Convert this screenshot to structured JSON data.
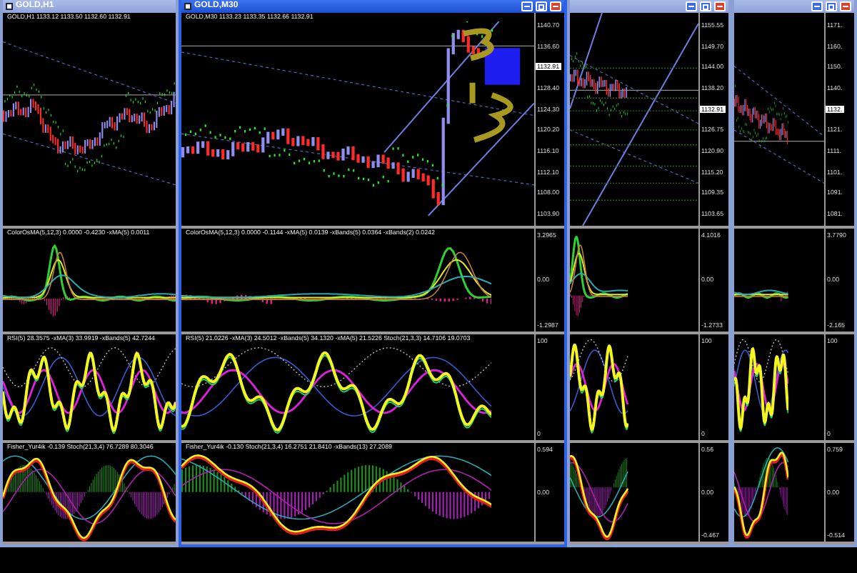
{
  "windows": [
    {
      "title": "GOLD,H1",
      "active": false,
      "title_buttons": false,
      "panes": [
        {
          "kind": "price",
          "header": "GOLD,H1 1133.12 1133.50 1132.60 1132.91"
        },
        {
          "kind": "osma",
          "header": "ColorOsMA(5,12,3) 0.0000 -0.4230 -xMA(5) 0.0011"
        },
        {
          "kind": "rsi",
          "header": "RSI(5) 28.3575 -xMA(3) 33.9919 -xBands(5) 42.7244"
        },
        {
          "kind": "fisher",
          "header": "Fisher_Yur4ik -0.139 Stoch(21,3,4) 76.7289 80.3046"
        }
      ]
    },
    {
      "title": "GOLD,M30",
      "active": true,
      "title_buttons": true,
      "panes": [
        {
          "kind": "price",
          "header": "GOLD,M30 1133.23 1133.35 1132.66 1132.91",
          "axis": [
            {
              "text": "1140.70",
              "current": false
            },
            {
              "text": "1136.60",
              "current": false
            },
            {
              "text": "1132.91",
              "current": true
            },
            {
              "text": "1128.40",
              "current": false
            },
            {
              "text": "1124.30",
              "current": false
            },
            {
              "text": "1120.20",
              "current": false
            },
            {
              "text": "1116.10",
              "current": false
            },
            {
              "text": "1112.10",
              "current": false
            },
            {
              "text": "1108.00",
              "current": false
            },
            {
              "text": "1103.90",
              "current": false
            }
          ]
        },
        {
          "kind": "osma",
          "header": "ColorOsMA(5,12,3) 0.0000 -0.1144 -xMA(5) 0.0139 -xBands(5) 0.0364 -xBands(2) 0.0242",
          "axis": [
            "3.2965",
            "0.00",
            "-1.2987"
          ]
        },
        {
          "kind": "rsi",
          "header": "RSI(5) 21.0226 -xMA(3) 24.5012 -xBands(5) 34.1320 -xMA(5) 21.5226 Stoch(21,3,3) 14.7106 19.0703",
          "axis": [
            "100",
            "0"
          ]
        },
        {
          "kind": "fisher",
          "header": "Fisher_Yur4ik -0.130 Stoch(21,3,4) 16.2751 21.8410 -xBands(13) 27.2089",
          "axis": [
            "0.594",
            "0.00"
          ]
        }
      ]
    },
    {
      "active": false,
      "title_buttons": true,
      "panes": [
        {
          "kind": "price",
          "axis": [
            {
              "text": "1155.55",
              "current": false
            },
            {
              "text": "1149.70",
              "current": false
            },
            {
              "text": "1144.00",
              "current": false
            },
            {
              "text": "1138.20",
              "current": false
            },
            {
              "text": "1132.91",
              "current": true
            },
            {
              "text": "1126.75",
              "current": false
            },
            {
              "text": "1120.90",
              "current": false
            },
            {
              "text": "1115.20",
              "current": false
            },
            {
              "text": "1109.35",
              "current": false
            },
            {
              "text": "1103.65",
              "current": false
            }
          ]
        },
        {
          "kind": "osma",
          "axis": [
            "4.1016",
            "0.00",
            "-1.2733"
          ]
        },
        {
          "kind": "rsi",
          "axis": [
            "100",
            "0"
          ]
        },
        {
          "kind": "fisher",
          "axis": [
            "0.56",
            "0.00",
            "-0.467"
          ]
        }
      ]
    },
    {
      "active": false,
      "title_buttons": true,
      "panes": [
        {
          "kind": "price",
          "axis": [
            {
              "text": "1171.",
              "current": false
            },
            {
              "text": "1160.",
              "current": false
            },
            {
              "text": "1150.",
              "current": false
            },
            {
              "text": "1140.",
              "current": false
            },
            {
              "text": "1132.",
              "current": true
            },
            {
              "text": "1121.",
              "current": false
            },
            {
              "text": "1111.",
              "current": false
            },
            {
              "text": "1101.",
              "current": false
            },
            {
              "text": "1091.",
              "current": false
            },
            {
              "text": "1081.",
              "current": false
            }
          ]
        },
        {
          "kind": "osma",
          "axis": [
            "3.7790",
            "0.00",
            "-2.165"
          ]
        },
        {
          "kind": "rsi",
          "axis": [
            "100",
            "0"
          ]
        },
        {
          "kind": "fisher",
          "axis": [
            "0.759",
            "0.00",
            "-0.514"
          ]
        }
      ]
    }
  ]
}
